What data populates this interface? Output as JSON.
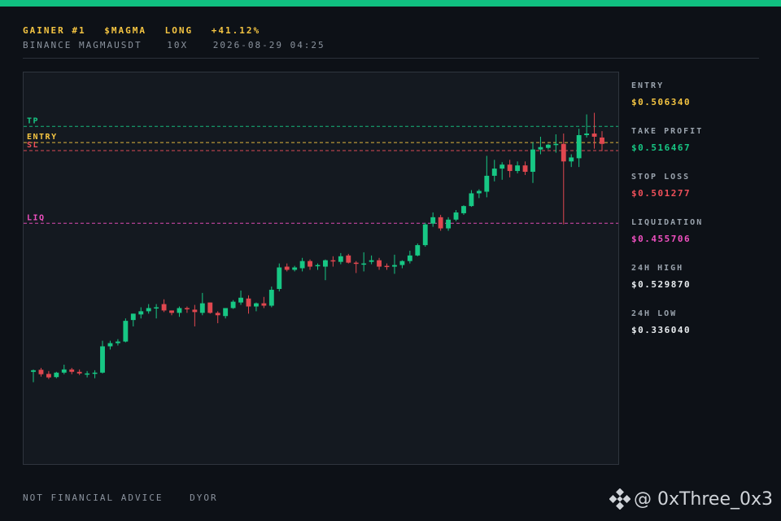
{
  "header": {
    "line1": [
      "GAINER #1",
      "$MAGMA",
      "LONG",
      "+41.12%"
    ],
    "line2": [
      "BINANCE MAGMAUSDT",
      "10X",
      "2026-08-29 04:25"
    ]
  },
  "stats": [
    {
      "label": "ENTRY",
      "value": "$0.506340",
      "color": "#f5c542"
    },
    {
      "label": "TAKE PROFIT",
      "value": "$0.516467",
      "color": "#17c784"
    },
    {
      "label": "STOP LOSS",
      "value": "$0.501277",
      "color": "#f0505a"
    },
    {
      "label": "LIQUIDATION",
      "value": "$0.455706",
      "color": "#f050c0"
    },
    {
      "label": "24H HIGH",
      "value": "$0.529870",
      "color": "#e8ecef"
    },
    {
      "label": "24H LOW",
      "value": "$0.336040",
      "color": "#e8ecef"
    }
  ],
  "footer": [
    "NOT FINANCIAL ADVICE",
    "DYOR"
  ],
  "watermark": {
    "text": "@ 0xThree_0x3",
    "icon": "binance-logo-icon"
  },
  "colors": {
    "up": "#17c784",
    "down": "#e0474f",
    "accent": "#10c080"
  },
  "chart_data": {
    "type": "candlestick",
    "ylim": [
      0.32,
      0.535
    ],
    "levels": [
      {
        "label": "TP",
        "value": 0.516467,
        "color": "#17c784"
      },
      {
        "label": "ENTRY",
        "value": 0.50634,
        "color": "#f5c542"
      },
      {
        "label": "SL",
        "value": 0.501277,
        "color": "#f0505a"
      },
      {
        "label": "LIQ",
        "value": 0.455706,
        "color": "#f050c0"
      }
    ],
    "candles": [
      [
        0.3625,
        0.364,
        0.356,
        0.3635
      ],
      [
        0.3638,
        0.365,
        0.3595,
        0.361
      ],
      [
        0.3612,
        0.363,
        0.358,
        0.359
      ],
      [
        0.3592,
        0.3625,
        0.3585,
        0.362
      ],
      [
        0.362,
        0.367,
        0.361,
        0.364
      ],
      [
        0.364,
        0.365,
        0.361,
        0.3625
      ],
      [
        0.3625,
        0.364,
        0.3605,
        0.3615
      ],
      [
        0.3615,
        0.363,
        0.359,
        0.3615
      ],
      [
        0.3615,
        0.3635,
        0.3585,
        0.362
      ],
      [
        0.362,
        0.382,
        0.3615,
        0.3785
      ],
      [
        0.3785,
        0.382,
        0.3765,
        0.3805
      ],
      [
        0.3805,
        0.383,
        0.379,
        0.3815
      ],
      [
        0.3815,
        0.396,
        0.381,
        0.3945
      ],
      [
        0.395,
        0.399,
        0.391,
        0.399
      ],
      [
        0.3985,
        0.403,
        0.396,
        0.4005
      ],
      [
        0.4005,
        0.405,
        0.399,
        0.4025
      ],
      [
        0.4025,
        0.405,
        0.396,
        0.403
      ],
      [
        0.405,
        0.408,
        0.4,
        0.401
      ],
      [
        0.401,
        0.401,
        0.398,
        0.3995
      ],
      [
        0.3995,
        0.4035,
        0.397,
        0.4025
      ],
      [
        0.4025,
        0.4035,
        0.3995,
        0.402
      ],
      [
        0.4015,
        0.4045,
        0.391,
        0.4
      ],
      [
        0.3995,
        0.412,
        0.398,
        0.4055
      ],
      [
        0.406,
        0.406,
        0.399,
        0.3995
      ],
      [
        0.3995,
        0.4005,
        0.393,
        0.398
      ],
      [
        0.3975,
        0.402,
        0.396,
        0.4025
      ],
      [
        0.4025,
        0.4075,
        0.402,
        0.4065
      ],
      [
        0.406,
        0.4135,
        0.4045,
        0.409
      ],
      [
        0.4085,
        0.4105,
        0.399,
        0.4035
      ],
      [
        0.4035,
        0.406,
        0.4005,
        0.4055
      ],
      [
        0.4055,
        0.4095,
        0.4025,
        0.404
      ],
      [
        0.404,
        0.416,
        0.403,
        0.414
      ],
      [
        0.4145,
        0.4305,
        0.413,
        0.428
      ],
      [
        0.4285,
        0.4305,
        0.4255,
        0.4265
      ],
      [
        0.4265,
        0.429,
        0.4255,
        0.428
      ],
      [
        0.4275,
        0.434,
        0.4255,
        0.432
      ],
      [
        0.432,
        0.433,
        0.4265,
        0.4285
      ],
      [
        0.429,
        0.4305,
        0.4265,
        0.4295
      ],
      [
        0.4285,
        0.433,
        0.42,
        0.4325
      ],
      [
        0.4325,
        0.435,
        0.4285,
        0.432
      ],
      [
        0.4315,
        0.437,
        0.43,
        0.435
      ],
      [
        0.4355,
        0.4365,
        0.4305,
        0.431
      ],
      [
        0.431,
        0.432,
        0.4245,
        0.4305
      ],
      [
        0.43,
        0.4375,
        0.4255,
        0.4305
      ],
      [
        0.4315,
        0.4355,
        0.43,
        0.4325
      ],
      [
        0.4325,
        0.434,
        0.4265,
        0.4285
      ],
      [
        0.429,
        0.4305,
        0.4265,
        0.4285
      ],
      [
        0.4285,
        0.436,
        0.424,
        0.4295
      ],
      [
        0.4295,
        0.4325,
        0.4275,
        0.432
      ],
      [
        0.432,
        0.4385,
        0.4305,
        0.4355
      ],
      [
        0.4355,
        0.443,
        0.435,
        0.442
      ],
      [
        0.442,
        0.456,
        0.441,
        0.455
      ],
      [
        0.4555,
        0.4625,
        0.4535,
        0.4595
      ],
      [
        0.4595,
        0.461,
        0.451,
        0.4525
      ],
      [
        0.4525,
        0.4595,
        0.451,
        0.458
      ],
      [
        0.458,
        0.464,
        0.457,
        0.4625
      ],
      [
        0.462,
        0.467,
        0.461,
        0.4665
      ],
      [
        0.4665,
        0.4765,
        0.466,
        0.4745
      ],
      [
        0.4745,
        0.477,
        0.4715,
        0.476
      ],
      [
        0.4755,
        0.498,
        0.472,
        0.4855
      ],
      [
        0.4855,
        0.4955,
        0.482,
        0.49
      ],
      [
        0.49,
        0.494,
        0.483,
        0.4925
      ],
      [
        0.4925,
        0.4955,
        0.4845,
        0.4885
      ],
      [
        0.4885,
        0.4945,
        0.487,
        0.492
      ],
      [
        0.492,
        0.4945,
        0.486,
        0.488
      ],
      [
        0.488,
        0.5065,
        0.481,
        0.502
      ],
      [
        0.502,
        0.51,
        0.499,
        0.5035
      ],
      [
        0.503,
        0.5055,
        0.502,
        0.505
      ],
      [
        0.505,
        0.5115,
        0.5,
        0.5055
      ],
      [
        0.5055,
        0.512,
        0.455,
        0.4945
      ],
      [
        0.4945,
        0.499,
        0.491,
        0.497
      ],
      [
        0.4965,
        0.515,
        0.491,
        0.511
      ],
      [
        0.511,
        0.524,
        0.5095,
        0.512
      ],
      [
        0.512,
        0.525,
        0.5025,
        0.51
      ],
      [
        0.5095,
        0.5135,
        0.501,
        0.5055
      ]
    ]
  }
}
